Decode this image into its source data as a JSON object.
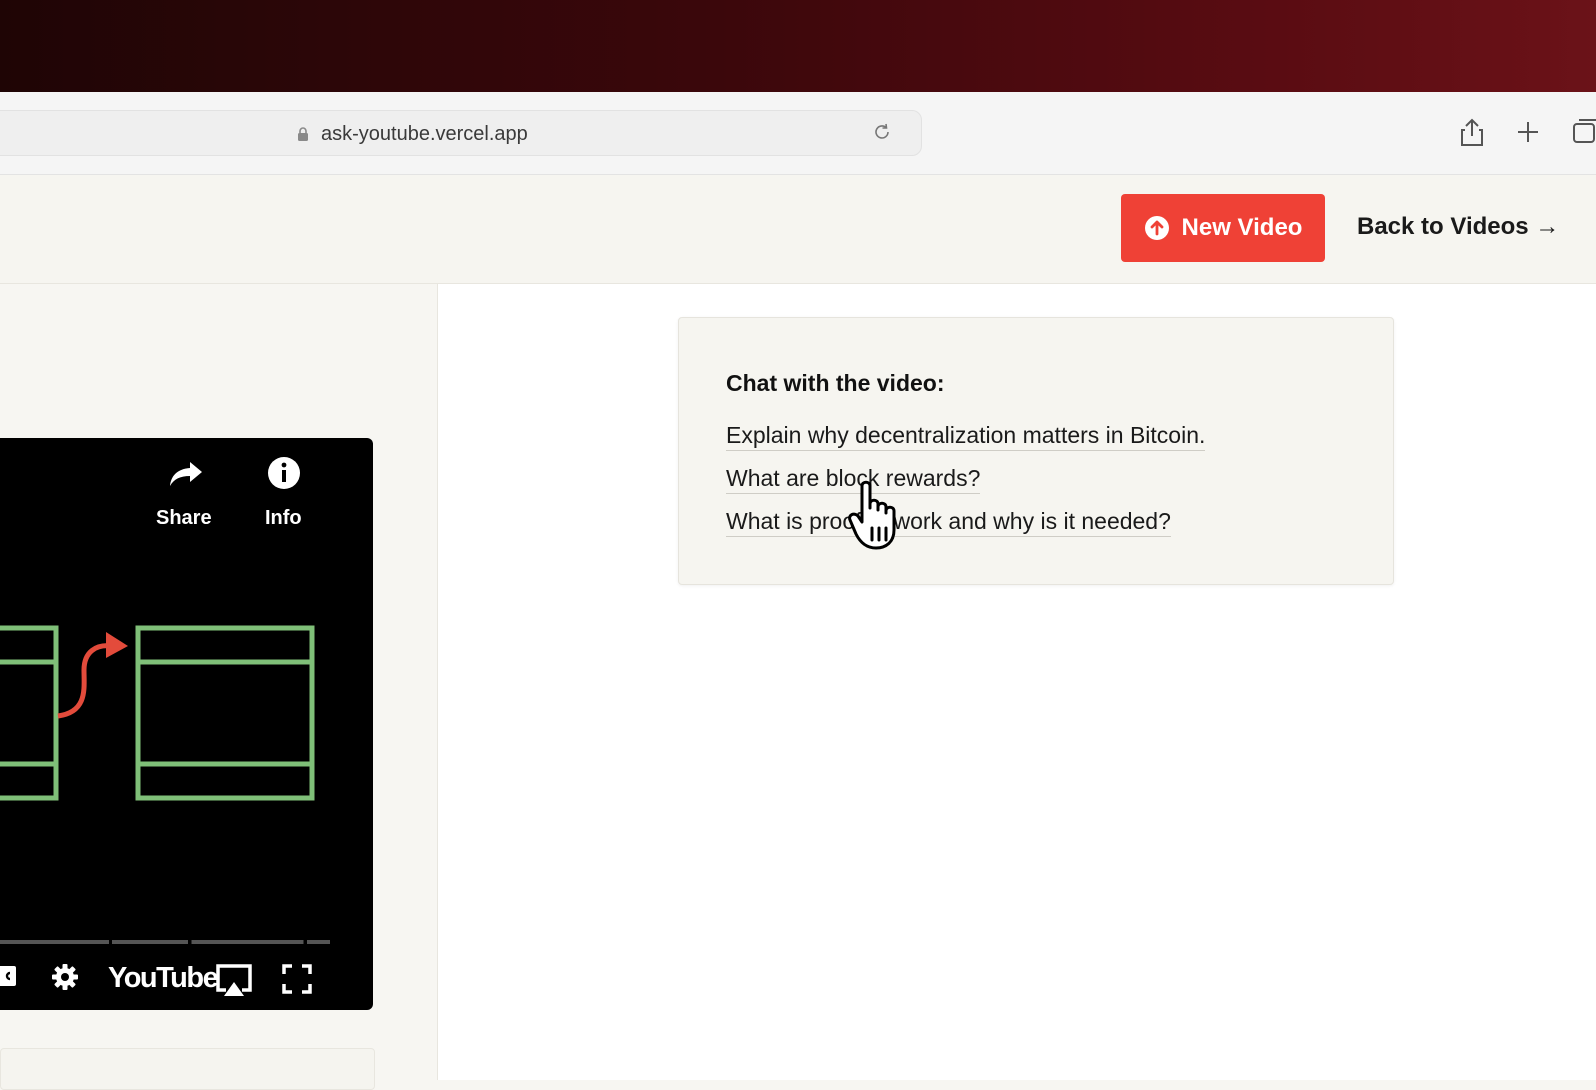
{
  "browser": {
    "url": "ask-youtube.vercel.app"
  },
  "header": {
    "new_video_label": "New Video",
    "back_label": "Back to Videos →",
    "accent_color": "#ef4136"
  },
  "video": {
    "share_label": "Share",
    "info_label": "Info",
    "logo_text": "YouTube"
  },
  "chat": {
    "title": "Chat with the video:",
    "suggestions": [
      "Explain why decentralization matters in Bitcoin.",
      "What are block rewards?",
      "What is proof of work and why is it needed?"
    ]
  }
}
